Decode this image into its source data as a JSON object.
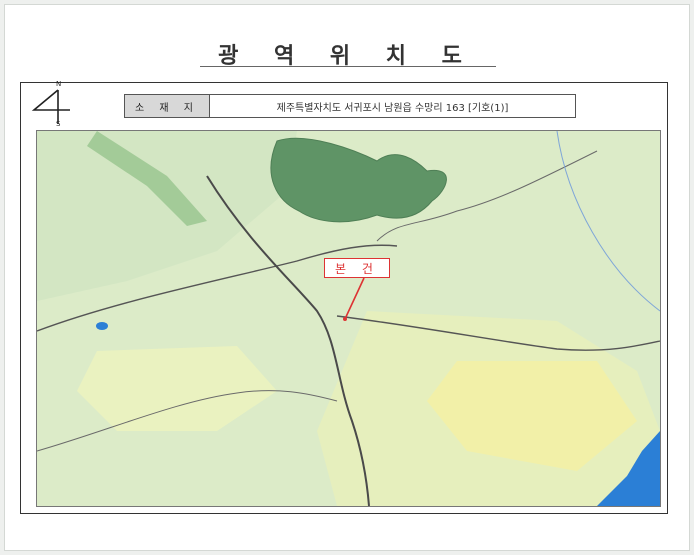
{
  "title": "광 역 위 치 도",
  "compass": {
    "north": "N",
    "south": "S",
    "icon": "north-arrow-icon"
  },
  "location": {
    "label": "소 재 지",
    "value": "제주특별자치도 서귀포시 남원읍 수망리 163 [기호(1)]"
  },
  "map": {
    "marker_label": "본 건",
    "colors": {
      "forest": "#5f9466",
      "land": "#dcebc8",
      "field": "#eaf2c0",
      "yellow": "#f2f0a8",
      "sea": "#2b7fd6",
      "road": "#4a4a4a",
      "marker": "#dd3333"
    }
  }
}
